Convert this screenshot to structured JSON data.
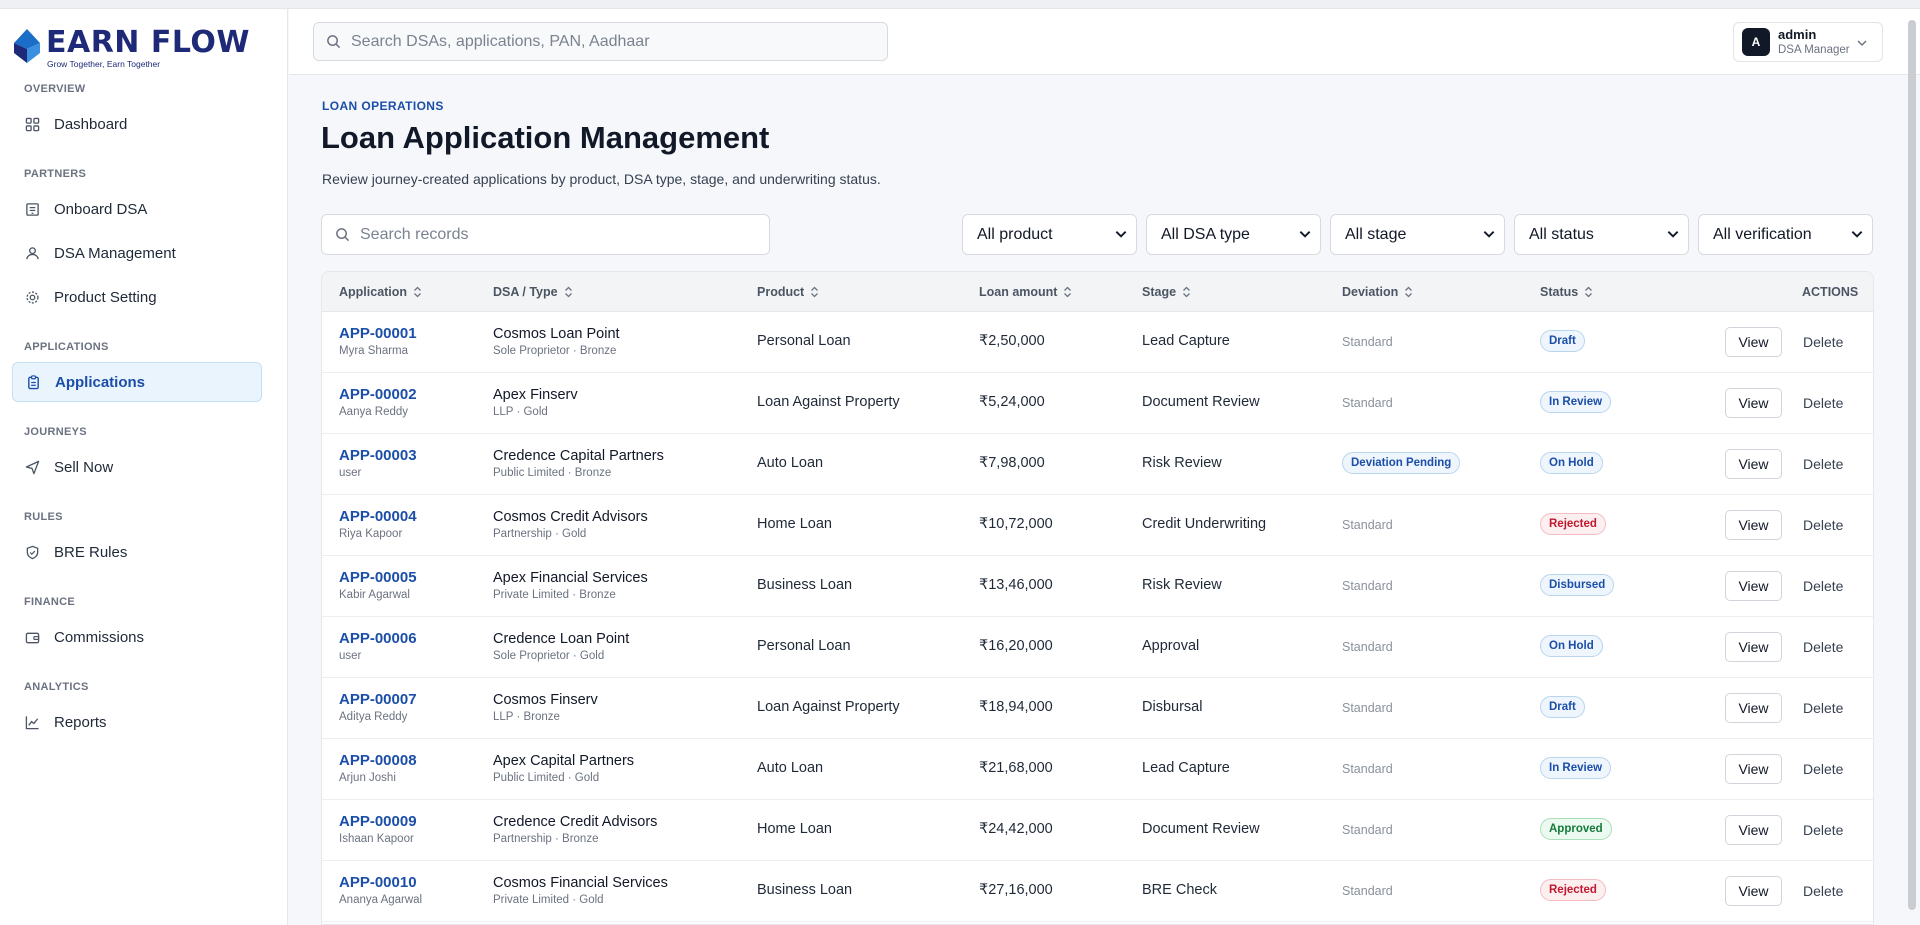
{
  "brand": {
    "name": "EARN FLOW",
    "tagline": "Grow Together, Earn Together"
  },
  "sidebar": {
    "sections": [
      {
        "title": "OVERVIEW",
        "items": [
          {
            "label": "Dashboard",
            "icon": "grid-icon"
          }
        ]
      },
      {
        "title": "PARTNERS",
        "items": [
          {
            "label": "Onboard DSA",
            "icon": "building-icon"
          },
          {
            "label": "DSA Management",
            "icon": "user-icon"
          },
          {
            "label": "Product Setting",
            "icon": "gear-icon"
          }
        ]
      },
      {
        "title": "APPLICATIONS",
        "items": [
          {
            "label": "Applications",
            "icon": "clipboard-icon",
            "active": true
          }
        ]
      },
      {
        "title": "JOURNEYS",
        "items": [
          {
            "label": "Sell Now",
            "icon": "send-icon"
          }
        ]
      },
      {
        "title": "RULES",
        "items": [
          {
            "label": "BRE Rules",
            "icon": "shield-icon"
          }
        ]
      },
      {
        "title": "FINANCE",
        "items": [
          {
            "label": "Commissions",
            "icon": "wallet-icon"
          }
        ]
      },
      {
        "title": "ANALYTICS",
        "items": [
          {
            "label": "Reports",
            "icon": "chart-line-icon"
          }
        ]
      }
    ]
  },
  "topbar": {
    "search_placeholder": "Search DSAs, applications, PAN, Aadhaar",
    "user": {
      "initial": "A",
      "name": "admin",
      "role": "DSA Manager"
    }
  },
  "page": {
    "eyebrow": "LOAN OPERATIONS",
    "title": "Loan Application Management",
    "description": "Review journey-created applications by product, DSA type, stage, and underwriting status."
  },
  "filters": {
    "search_placeholder": "Search records",
    "product": "All product",
    "dsa_type": "All DSA type",
    "stage": "All stage",
    "status": "All status",
    "verification": "All verification"
  },
  "table": {
    "headers": {
      "application": "Application",
      "dsa": "DSA / Type",
      "product": "Product",
      "loan_amount": "Loan amount",
      "stage": "Stage",
      "deviation": "Deviation",
      "status": "Status",
      "actions": "ACTIONS"
    },
    "view_label": "View",
    "delete_label": "Delete",
    "rows": [
      {
        "id": "APP-00001",
        "applicant": "Myra Sharma",
        "dsa": "Cosmos Loan Point",
        "dsa_type": "Sole Proprietor · Bronze",
        "product": "Personal Loan",
        "amount": "₹2,50,000",
        "stage": "Lead Capture",
        "deviation": "Standard",
        "status": "Draft"
      },
      {
        "id": "APP-00002",
        "applicant": "Aanya Reddy",
        "dsa": "Apex Finserv",
        "dsa_type": "LLP · Gold",
        "product": "Loan Against Property",
        "amount": "₹5,24,000",
        "stage": "Document Review",
        "deviation": "Standard",
        "status": "In Review"
      },
      {
        "id": "APP-00003",
        "applicant": "user",
        "dsa": "Credence Capital Partners",
        "dsa_type": "Public Limited · Bronze",
        "product": "Auto Loan",
        "amount": "₹7,98,000",
        "stage": "Risk Review",
        "deviation": "Deviation Pending",
        "status": "On Hold"
      },
      {
        "id": "APP-00004",
        "applicant": "Riya Kapoor",
        "dsa": "Cosmos Credit Advisors",
        "dsa_type": "Partnership · Gold",
        "product": "Home Loan",
        "amount": "₹10,72,000",
        "stage": "Credit Underwriting",
        "deviation": "Standard",
        "status": "Rejected"
      },
      {
        "id": "APP-00005",
        "applicant": "Kabir Agarwal",
        "dsa": "Apex Financial Services",
        "dsa_type": "Private Limited · Bronze",
        "product": "Business Loan",
        "amount": "₹13,46,000",
        "stage": "Risk Review",
        "deviation": "Standard",
        "status": "Disbursed"
      },
      {
        "id": "APP-00006",
        "applicant": "user",
        "dsa": "Credence Loan Point",
        "dsa_type": "Sole Proprietor · Gold",
        "product": "Personal Loan",
        "amount": "₹16,20,000",
        "stage": "Approval",
        "deviation": "Standard",
        "status": "On Hold"
      },
      {
        "id": "APP-00007",
        "applicant": "Aditya Reddy",
        "dsa": "Cosmos Finserv",
        "dsa_type": "LLP · Bronze",
        "product": "Loan Against Property",
        "amount": "₹18,94,000",
        "stage": "Disbursal",
        "deviation": "Standard",
        "status": "Draft"
      },
      {
        "id": "APP-00008",
        "applicant": "Arjun Joshi",
        "dsa": "Apex Capital Partners",
        "dsa_type": "Public Limited · Gold",
        "product": "Auto Loan",
        "amount": "₹21,68,000",
        "stage": "Lead Capture",
        "deviation": "Standard",
        "status": "In Review"
      },
      {
        "id": "APP-00009",
        "applicant": "Ishaan Kapoor",
        "dsa": "Credence Credit Advisors",
        "dsa_type": "Partnership · Bronze",
        "product": "Home Loan",
        "amount": "₹24,42,000",
        "stage": "Document Review",
        "deviation": "Standard",
        "status": "Approved"
      },
      {
        "id": "APP-00010",
        "applicant": "Ananya Agarwal",
        "dsa": "Cosmos Financial Services",
        "dsa_type": "Private Limited · Gold",
        "product": "Business Loan",
        "amount": "₹27,16,000",
        "stage": "BRE Check",
        "deviation": "Standard",
        "status": "Rejected"
      }
    ]
  },
  "status_colors": {
    "Draft": {
      "fg": "#1b4ea8",
      "bg": "#eef5fc",
      "border": "#b9d5ee"
    },
    "In Review": {
      "fg": "#1b4ea8",
      "bg": "#eef5fc",
      "border": "#b9d5ee"
    },
    "On Hold": {
      "fg": "#1b4ea8",
      "bg": "#eef5fc",
      "border": "#b9d5ee"
    },
    "Disbursed": {
      "fg": "#1b4ea8",
      "bg": "#eef5fc",
      "border": "#b9d5ee"
    },
    "Rejected": {
      "fg": "#c0182f",
      "bg": "#fdeef0",
      "border": "#f3bcc4"
    },
    "Approved": {
      "fg": "#137a3a",
      "bg": "#ecf9f0",
      "border": "#a9e0bb"
    },
    "Deviation Pending": {
      "fg": "#1b4ea8",
      "bg": "#eef5fc",
      "border": "#b9d5ee"
    }
  }
}
